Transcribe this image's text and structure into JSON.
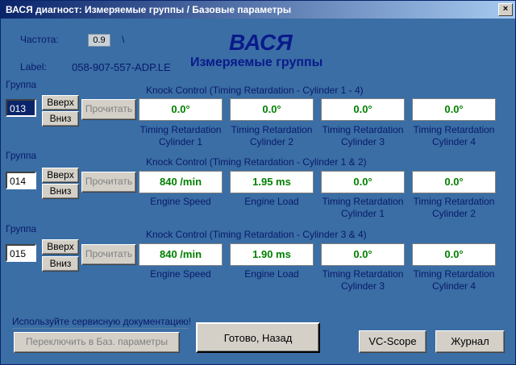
{
  "window": {
    "title": "ВАСЯ диагност: Измеряемые группы / Базовые параметры",
    "close_label": "×"
  },
  "info": {
    "freq_label": "Частота:",
    "freq_value": "0.9",
    "freq_suffix": "\\",
    "label_label": "Label:",
    "label_value": "058-907-557-ADP.LE"
  },
  "brand": {
    "name": "ВАСЯ",
    "subtitle": "Измеряемые группы"
  },
  "groups": [
    {
      "label": "Группа",
      "number": "013",
      "up": "Вверх",
      "down": "Вниз",
      "read": "Прочитать",
      "header": "Knock Control (Timing Retardation - Cylinder 1 - 4)",
      "fields": [
        {
          "value": "0.0°",
          "cap1": "Timing Retardation",
          "cap2": "Cylinder 1"
        },
        {
          "value": "0.0°",
          "cap1": "Timing Retardation",
          "cap2": "Cylinder 2"
        },
        {
          "value": "0.0°",
          "cap1": "Timing Retardation",
          "cap2": "Cylinder 3"
        },
        {
          "value": "0.0°",
          "cap1": "Timing Retardation",
          "cap2": "Cylinder 4"
        }
      ]
    },
    {
      "label": "Группа",
      "number": "014",
      "up": "Вверх",
      "down": "Вниз",
      "read": "Прочитать",
      "header": "Knock Control (Timing Retardation - Cylinder 1 & 2)",
      "fields": [
        {
          "value": "840 /min",
          "cap1": "Engine Speed",
          "cap2": ""
        },
        {
          "value": "1.95 ms",
          "cap1": "Engine Load",
          "cap2": ""
        },
        {
          "value": "0.0°",
          "cap1": "Timing Retardation",
          "cap2": "Cylinder 1"
        },
        {
          "value": "0.0°",
          "cap1": "Timing Retardation",
          "cap2": "Cylinder 2"
        }
      ]
    },
    {
      "label": "Группа",
      "number": "015",
      "up": "Вверх",
      "down": "Вниз",
      "read": "Прочитать",
      "header": "Knock Control (Timing Retardation - Cylinder 3 & 4)",
      "fields": [
        {
          "value": "840 /min",
          "cap1": "Engine Speed",
          "cap2": ""
        },
        {
          "value": "1.90 ms",
          "cap1": "Engine Load",
          "cap2": ""
        },
        {
          "value": "0.0°",
          "cap1": "Timing Retardation",
          "cap2": "Cylinder 3"
        },
        {
          "value": "0.0°",
          "cap1": "Timing Retardation",
          "cap2": "Cylinder 4"
        }
      ]
    }
  ],
  "footer": {
    "notice": "Используйте сервисную документацию!",
    "switch_label": "Переключить в Баз. параметры",
    "done_label": "Готово, Назад",
    "vcscope_label": "VC-Scope",
    "journal_label": "Журнал"
  },
  "colors": {
    "background": "#3a6ea5",
    "value_text": "#008000",
    "title_gradient_start": "#0a246a",
    "title_gradient_end": "#a6caf0"
  }
}
